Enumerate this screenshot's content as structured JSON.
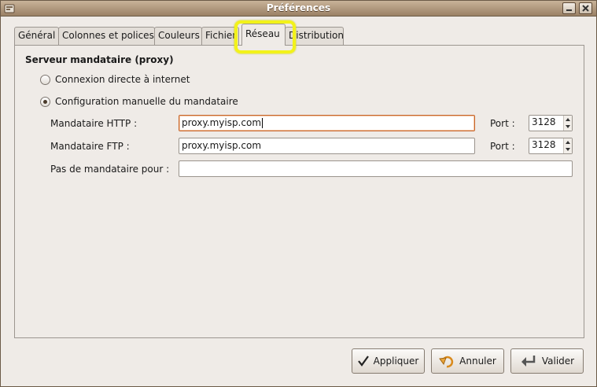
{
  "window": {
    "title": "Préférences"
  },
  "tabs": [
    {
      "label": "Général"
    },
    {
      "label": "Colonnes et polices"
    },
    {
      "label": "Couleurs"
    },
    {
      "label": "Fichier"
    },
    {
      "label": "Réseau"
    },
    {
      "label": "Distribution"
    }
  ],
  "active_tab": "Réseau",
  "proxy": {
    "section_title": "Serveur mandataire (proxy)",
    "direct_label": "Connexion directe à internet",
    "manual_label": "Configuration manuelle du mandataire",
    "selected": "manual",
    "http_label": "Mandataire HTTP :",
    "http_value": "proxy.myisp.com",
    "ftp_label": "Mandataire FTP :",
    "ftp_value": "proxy.myisp.com",
    "port_label": "Port :",
    "http_port": "3128",
    "ftp_port": "3128",
    "no_proxy_label": "Pas de mandataire pour :",
    "no_proxy_value": ""
  },
  "buttons": {
    "apply": "Appliquer",
    "cancel": "Annuler",
    "ok": "Valider"
  },
  "colors": {
    "highlight": "#f2f21a",
    "focus_border": "#c8662b"
  }
}
